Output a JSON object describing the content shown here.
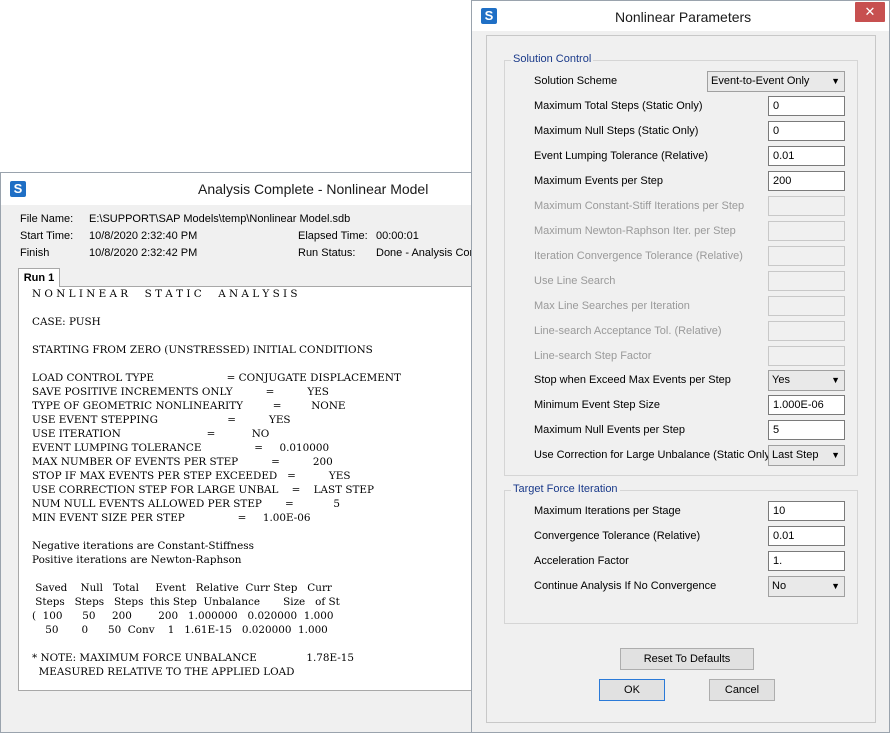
{
  "analysis_window": {
    "title": "Analysis Complete - Nonlinear Model",
    "file_name_label": "File Name:",
    "file_name": "E:\\SUPPORT\\SAP Models\\temp\\Nonlinear Model.sdb",
    "start_time_label": "Start Time:",
    "start_time": "10/8/2020  2:32:40 PM",
    "elapsed_time_label": "Elapsed Time:",
    "elapsed_time": "00:00:01",
    "finish_label": "Finish",
    "finish_time": "10/8/2020  2:32:42 PM",
    "run_status_label": "Run Status:",
    "run_status": "Done - Analysis Complete",
    "tab_label": "Run 1",
    "log_lines": [
      "N O N L I N E A R     S T A T I C     A N A L Y S I S",
      "",
      "CASE: PUSH",
      "",
      "STARTING FROM ZERO (UNSTRESSED) INITIAL CONDITIONS",
      "",
      "LOAD CONTROL TYPE                      = CONJUGATE DISPLACEMENT",
      "SAVE POSITIVE INCREMENTS ONLY          =          YES",
      "TYPE OF GEOMETRIC NONLINEARITY         =         NONE",
      "USE EVENT STEPPING                     =          YES",
      "USE ITERATION                          =           NO",
      "EVENT LUMPING TOLERANCE                =     0.010000",
      "MAX NUMBER OF EVENTS PER STEP          =          200",
      "STOP IF MAX EVENTS PER STEP EXCEEDED   =          YES",
      "USE CORRECTION STEP FOR LARGE UNBAL    =    LAST STEP",
      "NUM NULL EVENTS ALLOWED PER STEP       =            5",
      "MIN EVENT SIZE PER STEP                =     1.00E-06",
      "",
      "Negative iterations are Constant-Stiffness",
      "Positive iterations are Newton-Raphson",
      "",
      " Saved    Null   Total     Event   Relative  Curr Step   Curr",
      " Steps   Steps   Steps  this Step  Unbalance       Size   of St",
      "(  100      50     200        200   1.000000   0.020000  1.000",
      "    50       0      50  Conv    1   1.61E-15   0.020000  1.000",
      "",
      "* NOTE: MAXIMUM FORCE UNBALANCE               1.78E-15",
      "  MEASURED RELATIVE TO THE APPLIED LOAD"
    ]
  },
  "nonlinear_dialog": {
    "title": "Nonlinear Parameters",
    "close_glyph": "✕",
    "solution_control": {
      "title": "Solution Control",
      "scheme_label": "Solution Scheme",
      "scheme_value": "Event-to-Event Only",
      "rows": [
        {
          "label": "Maximum Total Steps (Static Only)",
          "value": "0",
          "enabled": true
        },
        {
          "label": "Maximum Null Steps (Static Only)",
          "value": "0",
          "enabled": true
        },
        {
          "label": "Event Lumping Tolerance (Relative)",
          "value": "0.01",
          "enabled": true
        },
        {
          "label": "Maximum Events per Step",
          "value": "200",
          "enabled": true
        },
        {
          "label": "Maximum Constant-Stiff Iterations per Step",
          "value": "",
          "enabled": false
        },
        {
          "label": "Maximum Newton-Raphson Iter. per Step",
          "value": "",
          "enabled": false
        },
        {
          "label": "Iteration Convergence Tolerance (Relative)",
          "value": "",
          "enabled": false
        },
        {
          "label": "Use Line Search",
          "value": "",
          "enabled": false
        },
        {
          "label": "Max Line Searches per Iteration",
          "value": "",
          "enabled": false
        },
        {
          "label": "Line-search Acceptance Tol. (Relative)",
          "value": "",
          "enabled": false
        },
        {
          "label": "Line-search Step Factor",
          "value": "",
          "enabled": false
        }
      ],
      "stop_label": "Stop when Exceed Max Events per Step",
      "stop_value": "Yes",
      "min_event_label": "Minimum Event Step Size",
      "min_event_value": "1.000E-06",
      "max_null_events_label": "Maximum Null Events per Step",
      "max_null_events_value": "5",
      "correction_label": "Use Correction for Large Unbalance (Static Only)",
      "correction_value": "Last Step"
    },
    "target_force": {
      "title": "Target Force Iteration",
      "max_iter_label": "Maximum Iterations per Stage",
      "max_iter_value": "10",
      "conv_tol_label": "Convergence Tolerance (Relative)",
      "conv_tol_value": "0.01",
      "accel_label": "Acceleration Factor",
      "accel_value": "1.",
      "continue_label": "Continue Analysis If No Convergence",
      "continue_value": "No"
    },
    "reset_label": "Reset To Defaults",
    "ok_label": "OK",
    "cancel_label": "Cancel"
  }
}
